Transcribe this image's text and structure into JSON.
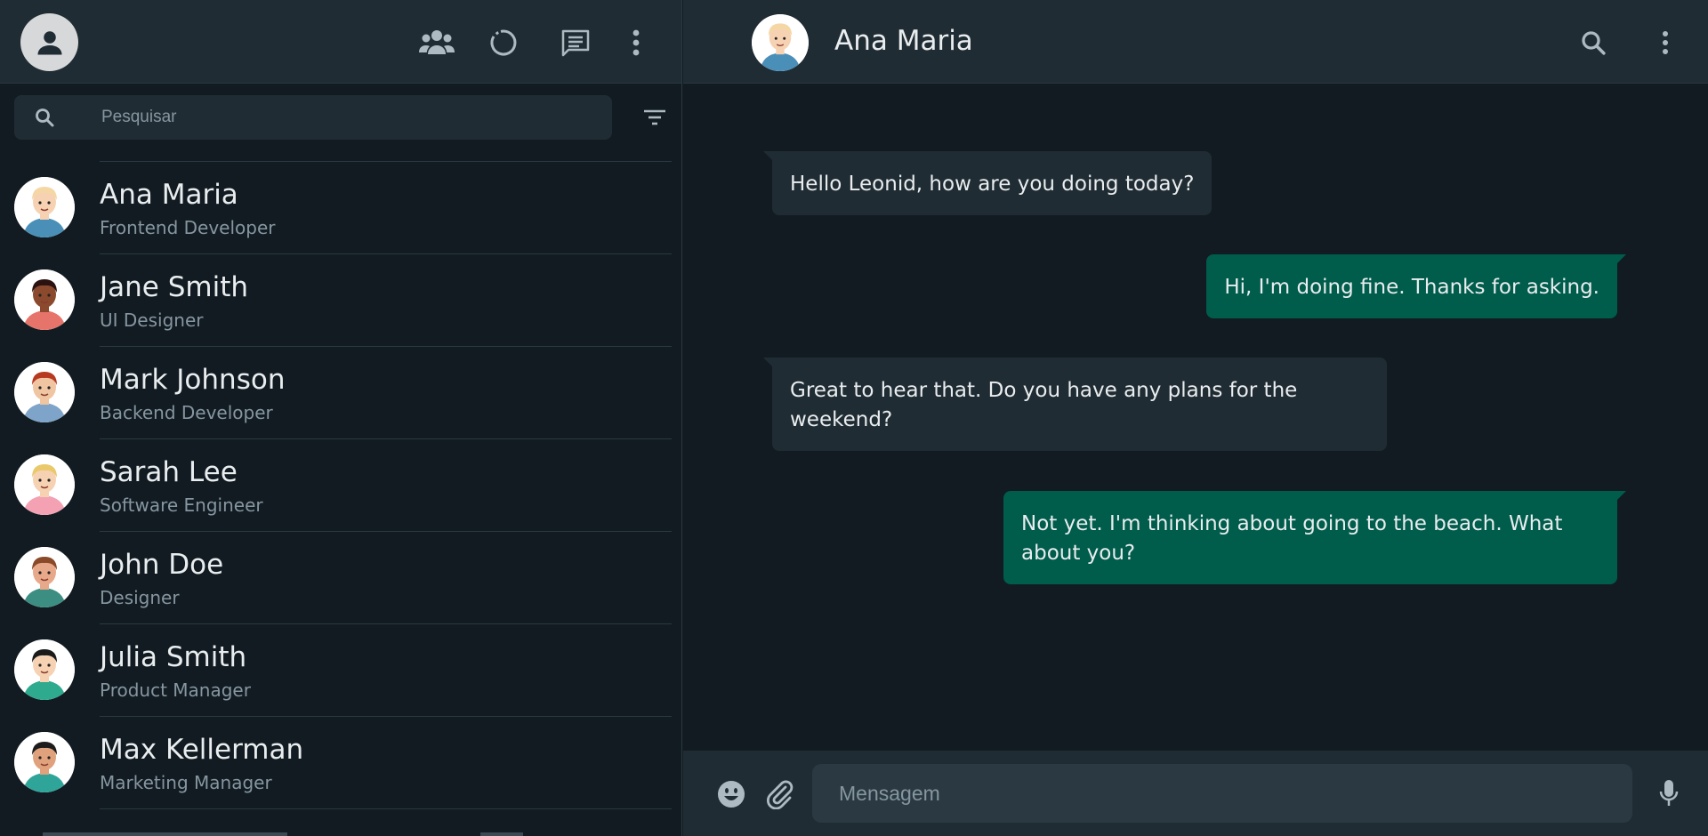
{
  "sidebar": {
    "search_placeholder": "Pesquisar",
    "contacts": [
      {
        "name": "Ana Maria",
        "role": "Frontend Developer",
        "avatar": "avatar-blonde-woman",
        "skin": "#f6d2b3",
        "hair": "#f5d7a6",
        "shirt": "#4a8fb8"
      },
      {
        "name": "Jane Smith",
        "role": "UI Designer",
        "avatar": "avatar-dark-curly-woman",
        "skin": "#8b4a2e",
        "hair": "#2a1210",
        "shirt": "#e7746a"
      },
      {
        "name": "Mark Johnson",
        "role": "Backend Developer",
        "avatar": "avatar-redhead-man",
        "skin": "#f0c5a2",
        "hair": "#b7391f",
        "shirt": "#7ea4c9"
      },
      {
        "name": "Sarah Lee",
        "role": "Software Engineer",
        "avatar": "avatar-blonde-glasses-woman",
        "skin": "#f6d2b3",
        "hair": "#e9c96a",
        "shirt": "#f3a1b3"
      },
      {
        "name": "John Doe",
        "role": "Designer",
        "avatar": "avatar-bearded-man",
        "skin": "#e7a98a",
        "hair": "#8a4a2a",
        "shirt": "#3d8e82"
      },
      {
        "name": "Julia Smith",
        "role": "Product Manager",
        "avatar": "avatar-black-hair-woman",
        "skin": "#f6d2b3",
        "hair": "#1b1b1b",
        "shirt": "#2eaa8e"
      },
      {
        "name": "Max Kellerman",
        "role": "Marketing Manager",
        "avatar": "avatar-black-beard-man",
        "skin": "#e0a27c",
        "hair": "#1c1c1c",
        "shirt": "#2fa59a"
      }
    ]
  },
  "chat": {
    "contact_name": "Ana Maria",
    "input_placeholder": "Mensagem",
    "messages": [
      {
        "direction": "in",
        "text": "Hello Leonid, how are you doing today?"
      },
      {
        "direction": "out",
        "text": "Hi, I'm doing fine. Thanks for asking."
      },
      {
        "direction": "in",
        "text": "Great to hear that. Do you have any plans for the weekend?"
      },
      {
        "direction": "out",
        "text": "Not yet. I'm thinking about going to the beach. What about you?"
      }
    ]
  },
  "colors": {
    "background": "#111b21",
    "panel_header": "#202c33",
    "incoming_bubble": "#202c33",
    "outgoing_bubble": "#005c4b",
    "icon": "#aebac1",
    "muted_text": "#8696a0"
  }
}
